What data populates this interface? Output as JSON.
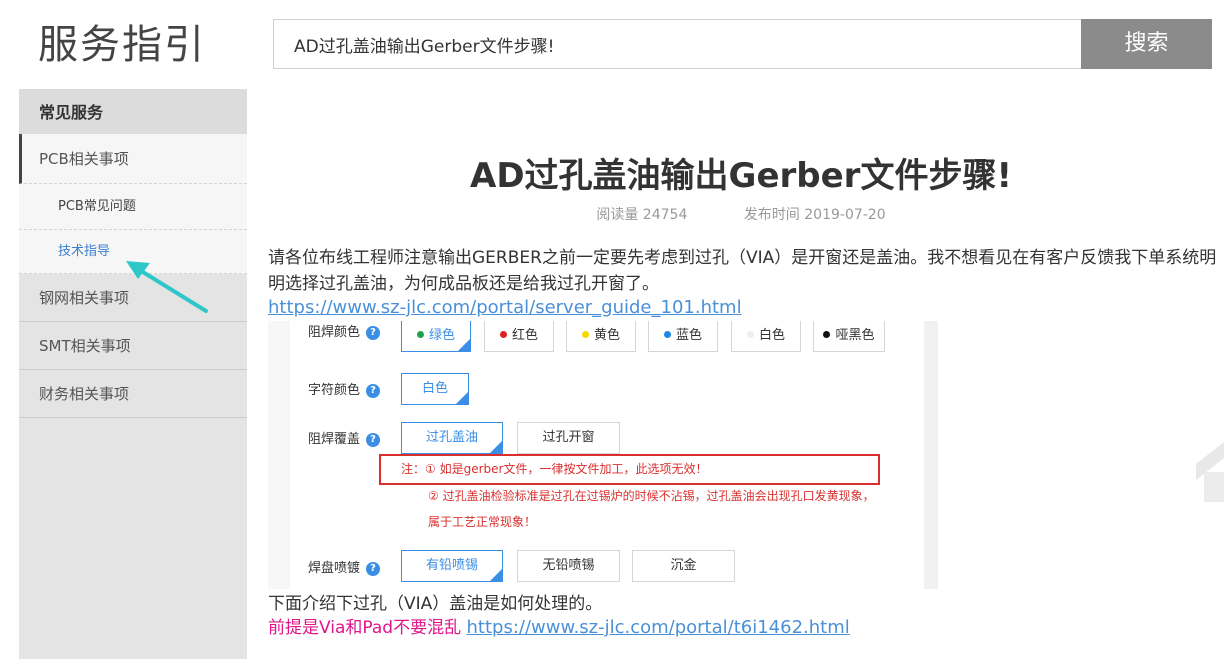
{
  "header": {
    "brand": "服务指引",
    "search_value": "AD过孔盖油输出Gerber文件步骤!",
    "search_button": "搜索"
  },
  "sidebar": {
    "heading": "常见服务",
    "items": [
      {
        "label": "PCB相关事项",
        "active": true
      },
      {
        "label": "钢网相关事项"
      },
      {
        "label": "SMT相关事项"
      },
      {
        "label": "财务相关事项"
      }
    ],
    "sub_items": [
      {
        "label": "PCB常见问题"
      },
      {
        "label": "技术指导",
        "current": true
      }
    ]
  },
  "article": {
    "title": "AD过孔盖油输出Gerber文件步骤!",
    "views": "阅读量 24754",
    "published": "发布时间 2019-07-20",
    "intro": "请各位布线工程师注意输出GERBER之前一定要先考虑到过孔（VIA）是开窗还是盖油。我不想看见在有客户反馈我下单系统明明选择过孔盖油，为何成品板还是给我过孔开窗了。",
    "link1": "https://www.sz-jlc.com/portal/server_guide_101.html",
    "para2": "下面介绍下过孔（VIA）盖油是如何处理的。",
    "para3_prefix": "前提是Via和Pad不要混乱",
    "link2": "https://www.sz-jlc.com/portal/t6i1462.html"
  },
  "screenshot": {
    "solder_color_label": "阻焊颜色",
    "solder_colors": [
      {
        "label": "绿色",
        "dot": "#1aa34a"
      },
      {
        "label": "红色",
        "dot": "#e02020"
      },
      {
        "label": "黄色",
        "dot": "#f5d800"
      },
      {
        "label": "蓝色",
        "dot": "#1e88e5"
      },
      {
        "label": "白色",
        "dot": "#eeeeee"
      },
      {
        "label": "哑黑色",
        "dot": "#111111"
      }
    ],
    "silk_color_label": "字符颜色",
    "silk_color": "白色",
    "cover_label": "阻焊覆盖",
    "cover_options": [
      "过孔盖油",
      "过孔开窗"
    ],
    "note1": "注：① 如是gerber文件，一律按文件加工，此选项无效！",
    "note2": "② 过孔盖油检验标准是过孔在过锡炉的时候不沾锡，过孔盖油会出现孔口发黄现象，",
    "note3": "属于工艺正常现象！",
    "surface_label": "焊盘喷镀",
    "surface_options": [
      "有铅喷锡",
      "无铅喷锡",
      "沉金"
    ],
    "help_glyph": "?"
  },
  "colors": {
    "accent": "#3a8ee6",
    "warning": "#d9302e",
    "pink": "#e0168a",
    "arrow": "#2ec7c9",
    "search_button_bg": "#8b8b8b"
  }
}
